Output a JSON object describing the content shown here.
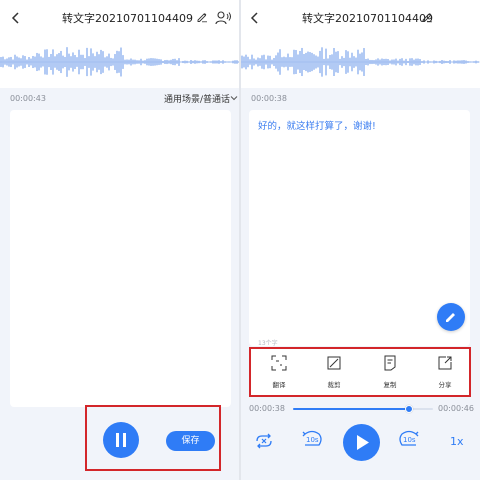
{
  "colors": {
    "accent": "#2f7cf6",
    "highlight_box": "#d3262a",
    "background": "#f1f4fa"
  },
  "left_screen": {
    "header": {
      "title": "转文字20210701104409",
      "back_icon": "chevron-left-icon",
      "edit_icon": "pencil-icon",
      "voice_icon": "voice-print-icon"
    },
    "elapsed": "00:00:43",
    "scene_select": "通用场景/普通话",
    "controls": {
      "pause_icon": "pause-icon",
      "save_label": "保存"
    }
  },
  "right_screen": {
    "header": {
      "title": "转文字20210701104409",
      "back_icon": "chevron-left-icon",
      "edit_icon": "pencil-icon"
    },
    "elapsed": "00:00:38",
    "transcript": "好的，就这样打算了，谢谢!",
    "char_count": "13个字",
    "tools": [
      {
        "label": "翻译",
        "icon": "translate-icon"
      },
      {
        "label": "裁剪",
        "icon": "crop-icon"
      },
      {
        "label": "复制",
        "icon": "copy-icon"
      },
      {
        "label": "分享",
        "icon": "share-icon"
      }
    ],
    "player": {
      "current_time": "00:00:38",
      "total_time": "00:00:46",
      "progress": 0.83,
      "speed": "1x",
      "rewind_label": "10s",
      "forward_label": "10s"
    }
  }
}
